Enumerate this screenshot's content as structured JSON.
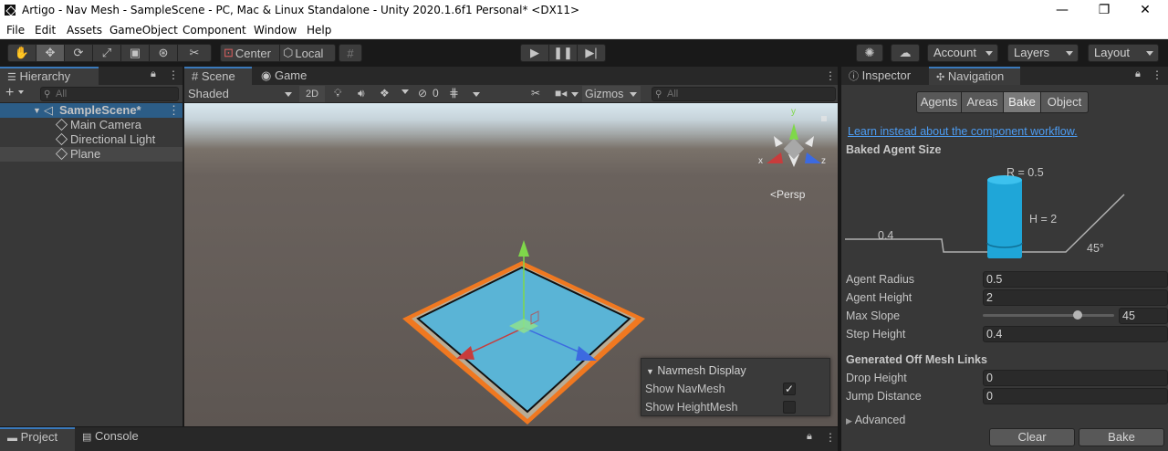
{
  "window": {
    "title": "Artigo - Nav Mesh - SampleScene - PC, Mac & Linux Standalone - Unity 2020.1.6f1 Personal* <DX11>",
    "minimize": "—",
    "maximize": "❐",
    "close": "✕"
  },
  "menu": [
    "File",
    "Edit",
    "Assets",
    "GameObject",
    "Component",
    "Window",
    "Help"
  ],
  "toolbar": {
    "pivot_mode": "Center",
    "pivot_space": "Local",
    "account": "Account",
    "layers": "Layers",
    "layout": "Layout"
  },
  "hierarchy": {
    "tab": "Hierarchy",
    "add": "+",
    "search_placeholder": "All",
    "scene_name": "SampleScene*",
    "items": [
      "Main Camera",
      "Directional Light",
      "Plane"
    ]
  },
  "scene": {
    "tabs": [
      "Scene",
      "Game"
    ],
    "shading": "Shaded",
    "mode_2d": "2D",
    "hidden_count": "0",
    "gizmos": "Gizmos",
    "search_placeholder": "All",
    "projection": "Persp",
    "axes": {
      "x": "x",
      "y": "y",
      "z": "z"
    },
    "navmesh_display": {
      "title": "Navmesh Display",
      "show_navmesh": "Show NavMesh",
      "show_navmesh_checked": true,
      "show_heightmesh": "Show HeightMesh",
      "show_heightmesh_checked": false
    }
  },
  "inspector": {
    "tabs": [
      "Inspector",
      "Navigation"
    ],
    "nav_tabs": [
      "Agents",
      "Areas",
      "Bake",
      "Object"
    ],
    "selected_nav_tab": "Bake",
    "link": "Learn instead about the component workflow.",
    "baked_agent_size": "Baked Agent Size",
    "diagram": {
      "radius": "R = 0.5",
      "height": "H = 2",
      "step": "0.4",
      "slope": "45°"
    },
    "fields": [
      {
        "label": "Agent Radius",
        "value": "0.5"
      },
      {
        "label": "Agent Height",
        "value": "2"
      },
      {
        "label": "Max Slope",
        "value": "45",
        "slider_fraction": 0.72
      },
      {
        "label": "Step Height",
        "value": "0.4"
      }
    ],
    "offmesh_header": "Generated Off Mesh Links",
    "offmesh_fields": [
      {
        "label": "Drop Height",
        "value": "0"
      },
      {
        "label": "Jump Distance",
        "value": "0"
      }
    ],
    "advanced": "Advanced",
    "clear": "Clear",
    "bake": "Bake"
  },
  "bottom": {
    "tabs": [
      "Project",
      "Console"
    ]
  },
  "colors": {
    "accent": "#3a79bb",
    "link": "#4c9cf2",
    "navmesh": "#5ab4d6",
    "plane_edge": "#f07820",
    "agent": "#1fa6d8"
  }
}
